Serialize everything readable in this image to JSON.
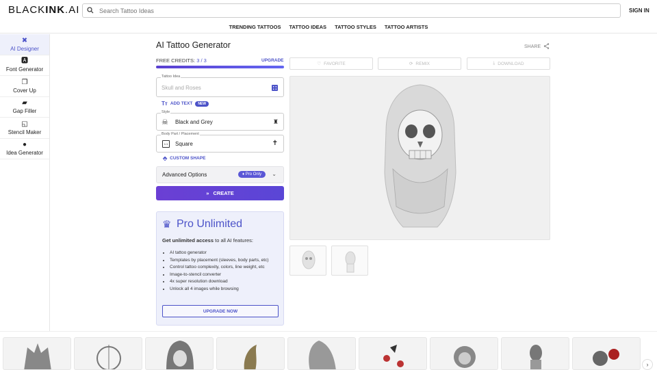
{
  "header": {
    "logo_light": "BLACK",
    "logo_bold": "INK",
    "logo_suffix": ".AI",
    "search_placeholder": "Search Tattoo Ideas",
    "signin": "SIGN IN"
  },
  "nav": [
    "TRENDING TATTOOS",
    "TATTOO IDEAS",
    "TATTOO STYLES",
    "TATTOO ARTISTS"
  ],
  "sidebar": [
    {
      "label": "AI Designer",
      "icon": "ai-designer-icon",
      "active": true
    },
    {
      "label": "Font Generator",
      "icon": "font-icon"
    },
    {
      "label": "Cover Up",
      "icon": "cover-up-icon"
    },
    {
      "label": "Gap Filler",
      "icon": "gap-filler-icon"
    },
    {
      "label": "Stencil Maker",
      "icon": "stencil-icon"
    },
    {
      "label": "Idea Generator",
      "icon": "lightbulb-icon"
    }
  ],
  "generator": {
    "title": "AI Tattoo Generator",
    "share": "SHARE",
    "credits_label": "FREE CREDITS:",
    "credits_value": "3 / 3",
    "credits_fraction": 1.0,
    "upgrade": "UPGRADE",
    "idea_label": "Tattoo Idea",
    "idea_placeholder": "Skull and Roses",
    "add_text": "ADD TEXT",
    "new_badge": "NEW",
    "style_label": "Style",
    "style_value": "Black and Grey",
    "placement_label": "Body Part / Placement",
    "placement_value": "Square",
    "custom_shape": "CUSTOM SHAPE",
    "advanced": "Advanced Options",
    "pro_only": "Pro Only",
    "create": "CREATE"
  },
  "pro": {
    "title": "Pro Unlimited",
    "sub_bold": "Get unlimited access",
    "sub_rest": " to all AI features:",
    "features": [
      "AI tattoo generator",
      "Templates by placement (sleeves, body parts, etc)",
      "Control tattoo complexity, colors, line weight, etc",
      "Image-to-stencil converter",
      "4x super resolution download",
      "Unlock all 4 images while browsing"
    ],
    "button": "UPGRADE NOW"
  },
  "actions": {
    "favorite": "FAVORITE",
    "remix": "REMIX",
    "download": "DOWNLOAD"
  },
  "colors": {
    "accent": "#4b52c8",
    "create_button": "#6b3fd4"
  }
}
